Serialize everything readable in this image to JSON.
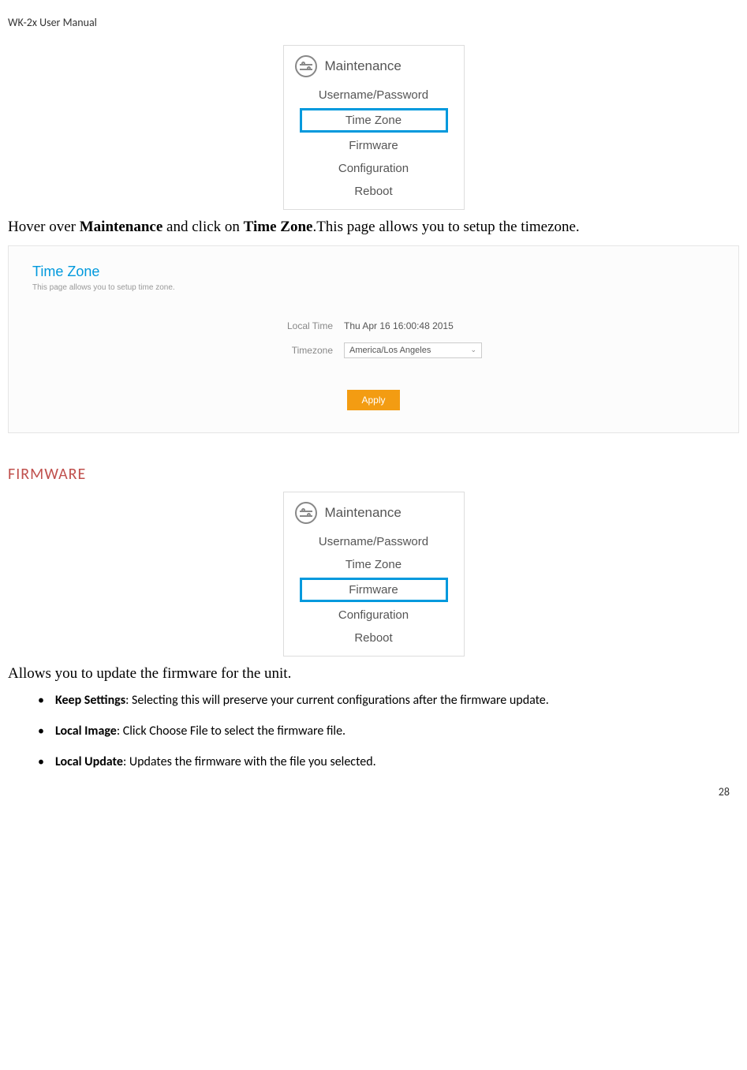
{
  "header": {
    "text": "WK-2x User Manual"
  },
  "menu1": {
    "title": "Maintenance",
    "items": [
      "Username/Password",
      "Time Zone",
      "Firmware",
      "Configuration",
      "Reboot"
    ],
    "highlightIndex": 1
  },
  "para1": {
    "pre": "Hover over ",
    "bold1": "Maintenance",
    "mid": " and click on ",
    "bold2": "Time Zone",
    "post": ".This page allows you to setup the timezone."
  },
  "tzPanel": {
    "title": "Time Zone",
    "subtitle": "This page allows you to setup time zone.",
    "localTimeLabel": "Local Time",
    "localTimeValue": "Thu Apr 16 16:00:48 2015",
    "timezoneLabel": "Timezone",
    "timezoneValue": "America/Los Angeles",
    "applyLabel": "Apply"
  },
  "sectionFirmware": "FIRMWARE",
  "menu2": {
    "title": "Maintenance",
    "items": [
      "Username/Password",
      "Time Zone",
      "Firmware",
      "Configuration",
      "Reboot"
    ],
    "highlightIndex": 2
  },
  "para2": "Allows you to update the firmware for the unit.",
  "bullets": [
    {
      "bold": "Keep Settings",
      "rest": ": Selecting this will preserve your current configurations after the firmware update."
    },
    {
      "bold": "Local Image",
      "rest": ": Click Choose File to select the firmware file."
    },
    {
      "bold": "Local Update",
      "rest": ": Updates the firmware with the file you selected."
    }
  ],
  "pageNum": "28"
}
